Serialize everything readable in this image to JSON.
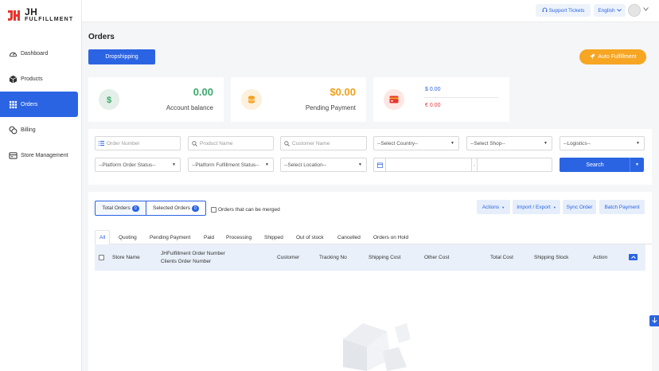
{
  "app": {
    "logo_top": "JH",
    "logo_bottom": "FULFILLMENT",
    "accent_color": "#2b64e3"
  },
  "sidebar": {
    "items": [
      {
        "label": "Dashboard",
        "icon": "gauge-icon",
        "active": false
      },
      {
        "label": "Products",
        "icon": "box-icon",
        "active": false
      },
      {
        "label": "Orders",
        "icon": "grid-icon",
        "active": true
      },
      {
        "label": "Billing",
        "icon": "coins-icon",
        "active": false
      },
      {
        "label": "Store Management",
        "icon": "store-icon",
        "active": false
      }
    ]
  },
  "topbar": {
    "support_label": "Support Tickets",
    "language_label": "English"
  },
  "page": {
    "title": "Orders",
    "dropshipping_label": "Dropshipping",
    "auto_fulfillment_label": "Auto Fulfillment"
  },
  "cards": {
    "balance": {
      "value": "0.00",
      "label": "Account balance",
      "icon": "dollar-icon"
    },
    "pending": {
      "value": "$0.00",
      "label": "Pending Payment",
      "icon": "coin-stack-icon"
    },
    "currency": {
      "usd": "$ 0.00",
      "eur": "€ 0.00",
      "icon": "credit-card-icon"
    }
  },
  "filters": {
    "order_number_placeholder": "Order Number",
    "product_name_placeholder": "Product Name",
    "customer_name_placeholder": "Customer Name",
    "country_select": "--Select Country--",
    "shop_select": "--Select Shop--",
    "logistics_select": "--Logistics--",
    "platform_order_status": "--Platform Order Status--",
    "platform_fulfillment_status": "--Platform Fulfillment Status--",
    "location_select": "--Select Location--",
    "date_separator": "-",
    "search_label": "Search"
  },
  "orders": {
    "total_orders_label": "Total Orders",
    "total_orders_count": "0",
    "selected_orders_label": "Selected Orders",
    "selected_orders_count": "0",
    "merge_label": "Orders that can be merged",
    "actions": [
      {
        "label": "Actions",
        "caret": true
      },
      {
        "label": "Import / Export",
        "caret": true
      },
      {
        "label": "Sync Order",
        "caret": false
      },
      {
        "label": "Batch Payment",
        "caret": false
      }
    ],
    "tabs": [
      "All",
      "Quoting",
      "Pending Payment",
      "Paid",
      "Processing",
      "Shipped",
      "Out of stock",
      "Cancelled",
      "Orders on Hold"
    ],
    "columns": {
      "store_name": "Store Name",
      "order_number_1": "JHFulfillment Order Number",
      "order_number_2": "Clients Order Number",
      "customer": "Customer",
      "tracking": "Tracking No",
      "shipping_cost": "Shipping Cost",
      "other_cost": "Other Cost",
      "total_cost": "Total Cost",
      "shipping_stock": "Shipping Stock",
      "action": "Action"
    }
  }
}
